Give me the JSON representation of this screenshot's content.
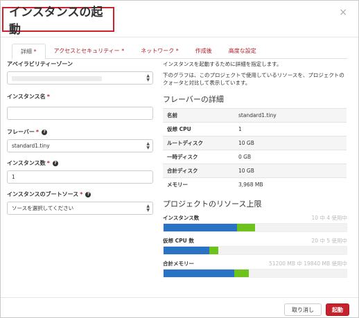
{
  "dialog": {
    "title": "インスタンスの起動",
    "close": "×"
  },
  "tabs": [
    {
      "label": "詳細",
      "req": " *"
    },
    {
      "label": "アクセスとセキュリティー",
      "req": " *"
    },
    {
      "label": "ネットワーク",
      "req": " *"
    },
    {
      "label": "作成後",
      "req": ""
    },
    {
      "label": "高度な設定",
      "req": ""
    }
  ],
  "form": {
    "availability_zone": {
      "label": "アベイラビリティーゾーン",
      "value": ""
    },
    "instance_name": {
      "label": "インスタンス名",
      "req": "*",
      "value": ""
    },
    "flavor": {
      "label": "フレーバー",
      "req": "*",
      "value": "standard1.tiny"
    },
    "instance_count": {
      "label": "インスタンス数",
      "req": "*",
      "value": "1"
    },
    "boot_source": {
      "label": "インスタンスのブートソース",
      "req": "*",
      "value": "ソースを選択してください"
    }
  },
  "info": {
    "desc1": "インスタンスを起動するために詳細を指定します。",
    "desc2": "下のグラフは、このプロジェクトで使用しているリソースを、プロジェクトのクォータと対比して表示しています。",
    "flavor_title": "フレーバーの詳細",
    "flavor_rows": [
      {
        "k": "名前",
        "v": "standard1.tiny"
      },
      {
        "k": "仮想 CPU",
        "v": "1"
      },
      {
        "k": "ルートディスク",
        "v": "10 GB"
      },
      {
        "k": "一時ディスク",
        "v": "0 GB"
      },
      {
        "k": "合計ディスク",
        "v": "10 GB"
      },
      {
        "k": "メモリー",
        "v": "3,968 MB"
      }
    ],
    "limits_title": "プロジェクトのリソース上限",
    "limits": [
      {
        "k": "インスタンス数",
        "v": "10 中 4 使用中",
        "used": 0.4,
        "added": 0.1
      },
      {
        "k": "仮想 CPU 数",
        "v": "20 中 5 使用中",
        "used": 0.25,
        "added": 0.05
      },
      {
        "k": "合計メモリー",
        "v": "51200 MB 中 19840 MB 使用中",
        "used": 0.388,
        "added": 0.077
      }
    ]
  },
  "footer": {
    "cancel": "取り消し",
    "launch": "起動"
  },
  "colors": {
    "accent": "#c5222c",
    "used": "#2a73c4",
    "added": "#6dc21c"
  }
}
